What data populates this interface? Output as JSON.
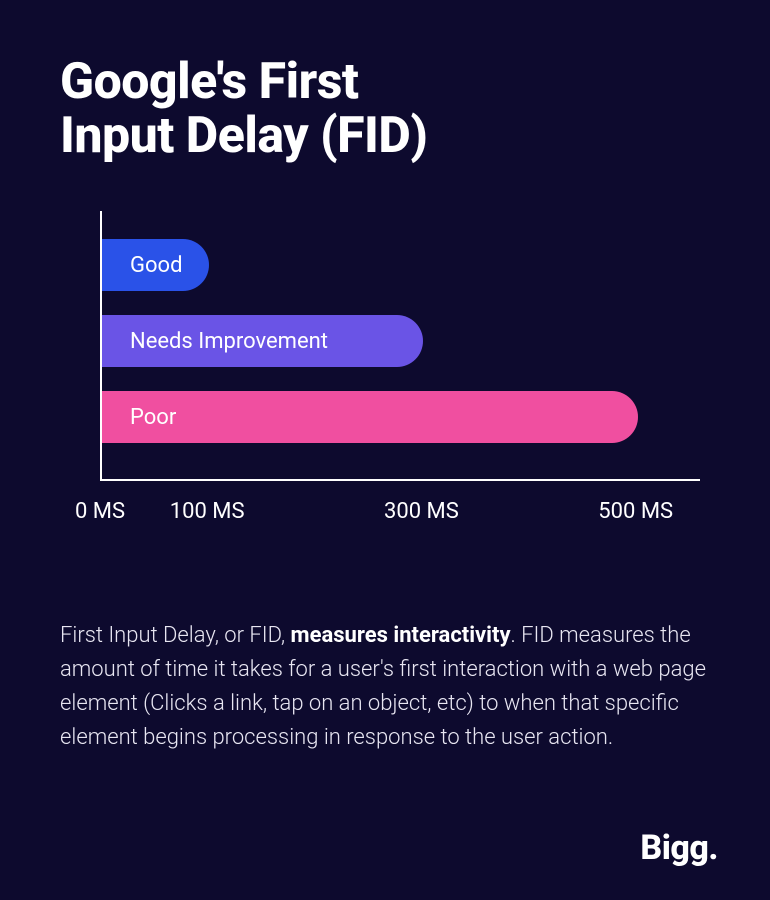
{
  "title_line1": "Google's First",
  "title_line2": "Input Delay (FID)",
  "chart_data": {
    "type": "bar",
    "orientation": "horizontal",
    "categories": [
      "Good",
      "Needs Improvement",
      "Poor"
    ],
    "values": [
      100,
      300,
      500
    ],
    "colors": [
      "#2a52e8",
      "#6a54e6",
      "#f04fa0"
    ],
    "xlabel": "",
    "ylabel": "",
    "x_ticks": [
      "0 MS",
      "100 MS",
      "300 MS",
      "500 MS"
    ],
    "x_tick_values": [
      0,
      100,
      300,
      500
    ],
    "xlim": [
      0,
      560
    ],
    "title": ""
  },
  "bars": [
    {
      "label": "Good",
      "value": 100,
      "class": "bar-good"
    },
    {
      "label": "Needs Improvement",
      "value": 300,
      "class": "bar-needs"
    },
    {
      "label": "Poor",
      "value": 500,
      "class": "bar-poor"
    }
  ],
  "axis": {
    "ticks": [
      {
        "label": "0 MS",
        "value": 0
      },
      {
        "label": "100 MS",
        "value": 100
      },
      {
        "label": "300 MS",
        "value": 300
      },
      {
        "label": "500 MS",
        "value": 500
      }
    ],
    "max": 560
  },
  "description": {
    "pre": "First Input Delay, or FID, ",
    "bold": "measures interactivity",
    "post": ". FID measures the amount of time it takes for a user's first interaction with a web page element (Clicks a link, tap on an object, etc) to when that specific element begins processing in response to the user action."
  },
  "brand": "Bigg."
}
